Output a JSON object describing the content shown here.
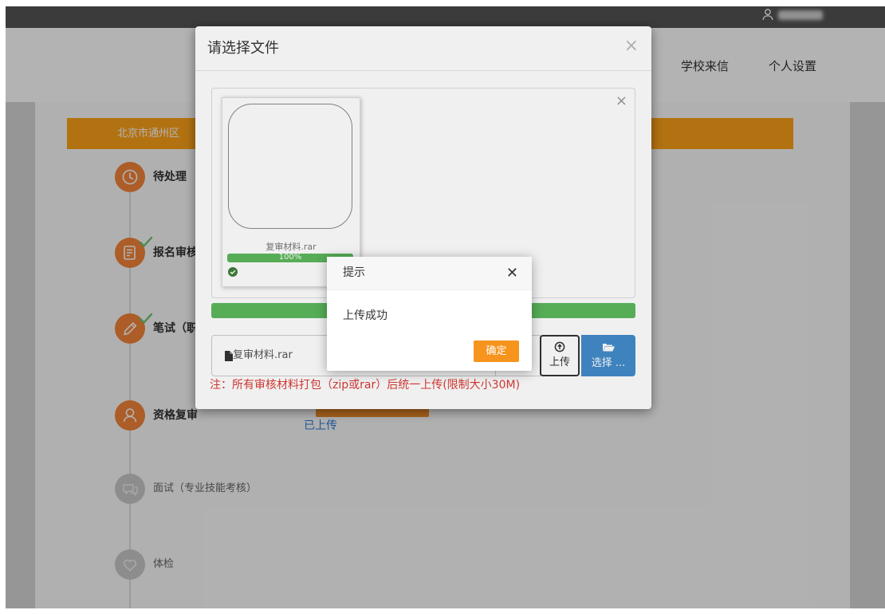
{
  "topbar": {
    "user_icon": "user-icon"
  },
  "header": {
    "nav": [
      {
        "label": "学校来信"
      },
      {
        "label": "个人设置"
      }
    ]
  },
  "banner": {
    "text": "北京市通州区"
  },
  "timeline": {
    "steps": [
      {
        "label": "待处理",
        "icon": "clock-icon",
        "state": "active",
        "completed": false
      },
      {
        "label": "报名审核",
        "icon": "document-icon",
        "state": "active",
        "completed": true
      },
      {
        "label": "笔试（职",
        "icon": "pencil-icon",
        "state": "active",
        "completed": true
      },
      {
        "label": "资格复审",
        "icon": "user-icon",
        "state": "active",
        "completed": false
      },
      {
        "label": "面试（专业技能考核）",
        "icon": "interview-icon",
        "state": "inactive",
        "completed": false
      },
      {
        "label": "体检",
        "icon": "heart-icon",
        "state": "inactive",
        "completed": false
      }
    ]
  },
  "requalification": {
    "status_text": "已上传"
  },
  "file_modal": {
    "title": "请选择文件",
    "close_symbol": "×",
    "preview": {
      "close_symbol": "×",
      "file_name": "复审材料.rar",
      "progress": 1.0,
      "progress_label": "100%",
      "status_icon": "check-circle-icon"
    },
    "overall_progress": 1.0,
    "input_value": "复审材料.rar",
    "input_icon": "file-icon",
    "upload_label": "上传",
    "upload_icon": "upload-circle-icon",
    "browse_label": "选择 ...",
    "browse_icon": "folder-open-icon",
    "note": "注：所有审核材料打包（zip或rar）后统一上传(限制大小30M)"
  },
  "alert": {
    "title": "提示",
    "close_symbol": "✕",
    "message": "上传成功",
    "confirm_label": "确定"
  },
  "colors": {
    "banner_orange": "#ffa31a",
    "step_active": "#f5853a",
    "step_inactive": "#c9c9c9",
    "check_green": "#6cc36c",
    "progress_green": "#5cb85c",
    "primary_blue": "#428bca",
    "note_red": "#db3a34",
    "confirm_orange": "#f7941d",
    "link_blue": "#2a7bd6"
  }
}
